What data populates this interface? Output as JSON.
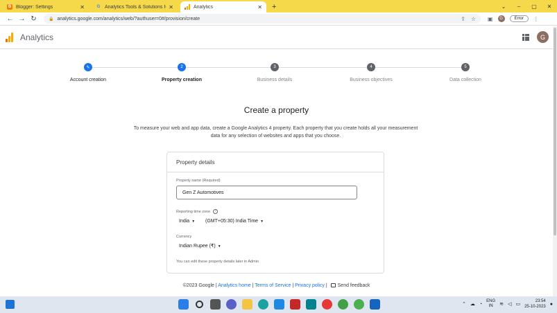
{
  "browser": {
    "tabs": [
      {
        "title": "Blogger: Settings",
        "favicon": "blogger-icon",
        "color": "#f57c00"
      },
      {
        "title": "Analytics Tools & Solutions for Y",
        "favicon": "google-icon",
        "color": "#4285f4"
      },
      {
        "title": "Analytics",
        "favicon": "analytics-icon",
        "color": "#f9ab00"
      }
    ],
    "new_tab": "+",
    "url": "analytics.google.com/analytics/web/?authuser=0#/provision/create",
    "profile_initial": "G",
    "error_label": "Error"
  },
  "app": {
    "title": "Analytics",
    "avatar_initial": "G"
  },
  "stepper": {
    "steps": [
      {
        "number": "✎",
        "label": "Account creation",
        "state": "done"
      },
      {
        "number": "2",
        "label": "Property creation",
        "state": "active"
      },
      {
        "number": "3",
        "label": "Business details",
        "state": "todo"
      },
      {
        "number": "4",
        "label": "Business objectives",
        "state": "todo"
      },
      {
        "number": "5",
        "label": "Data collection",
        "state": "todo"
      }
    ]
  },
  "main": {
    "heading": "Create a property",
    "intro": "To measure your web and app data, create a Google Analytics 4 property. Each property that you create holds all your measurement data for any selection of websites and apps that you choose."
  },
  "card": {
    "title": "Property details",
    "property_name_label": "Property name (Required)",
    "property_name_value": "Gen Z Automotives",
    "timezone_label": "Reporting time zone",
    "timezone_country": "India",
    "timezone_value": "(GMT+05:30) India Time",
    "currency_label": "Currency",
    "currency_value": "Indian Rupee (₹)",
    "note": "You can edit these property details later in Admin"
  },
  "footer": {
    "copyright": "©2023 Google",
    "links": [
      "Analytics home",
      "Terms of Service",
      "Privacy policy"
    ],
    "feedback": "Send feedback"
  },
  "taskbar": {
    "lang_top": "ENG",
    "lang_bottom": "IN",
    "time": "23:54",
    "date": "25-10-2023"
  },
  "colors": {
    "accent": "#1a73e8",
    "browser_frame": "#f6d94a",
    "inactive_step": "#5f6368"
  }
}
